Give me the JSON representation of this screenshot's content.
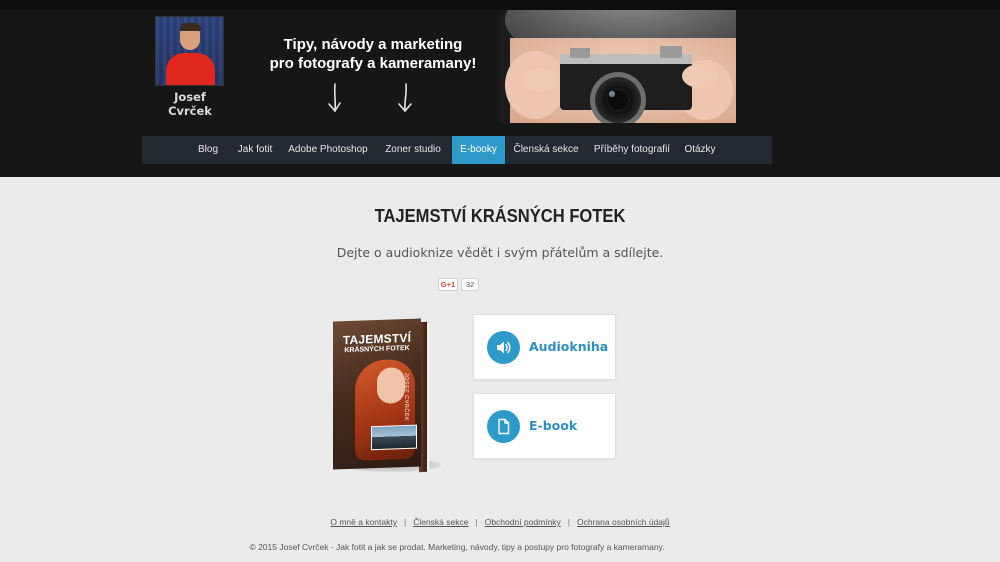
{
  "header": {
    "author_name": "Josef Cvrček",
    "tagline_line1": "Tipy, návody a marketing",
    "tagline_line2": "pro fotografy a kameramany!"
  },
  "nav": {
    "items": [
      {
        "label": "Blog"
      },
      {
        "label": "Jak fotit"
      },
      {
        "label": "Adobe Photoshop"
      },
      {
        "label": "Zoner studio"
      },
      {
        "label": "E-booky",
        "active": true
      },
      {
        "label": "Členská sekce"
      },
      {
        "label": "Příběhy fotografií"
      },
      {
        "label": "Otázky"
      }
    ],
    "active_color": "#2e9ac9"
  },
  "main": {
    "title": "TAJEMSTVÍ KRÁSNÝCH FOTEK",
    "subtitle": "Dejte o audioknize vědět i svým přátelům a sdílejte.",
    "gplus_label": "G+1",
    "share_count": "32",
    "book": {
      "title_line1": "TAJEMSTVÍ",
      "title_line2": "KRÁSNÝCH FOTEK",
      "author": "JOSEF CVRČEK"
    },
    "cards": [
      {
        "label": "Audiokniha",
        "icon": "speaker-icon"
      },
      {
        "label": "E-book",
        "icon": "document-icon"
      }
    ]
  },
  "footer": {
    "links": [
      {
        "label": "O mně a kontakty"
      },
      {
        "label": "Členská sekce"
      },
      {
        "label": "Obchodní podmínky"
      },
      {
        "label": "Ochrana osobních údajů"
      }
    ],
    "separator": "|",
    "copyright": "© 2015 Josef Cvrček - Jak fotit a jak se prodat. Marketing, návody, tipy a postupy pro fotografy a kameramany."
  }
}
